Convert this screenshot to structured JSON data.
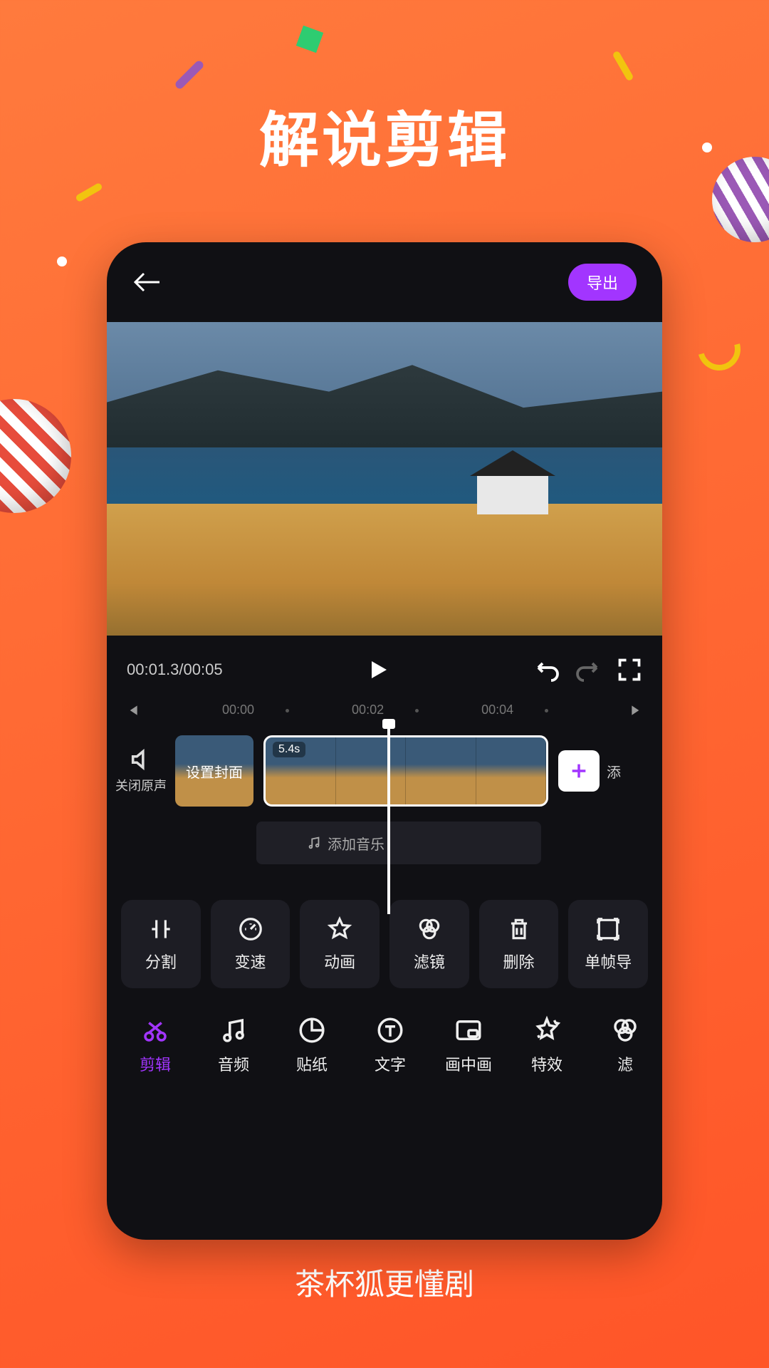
{
  "promo": {
    "title": "解说剪辑",
    "subtitle": "茶杯狐更懂剧"
  },
  "editor": {
    "export_label": "导出",
    "time_current": "00:01.3",
    "time_total": "00:05",
    "ruler_ticks": [
      "00:00",
      "00:02",
      "00:04"
    ],
    "mute_label": "关闭原声",
    "cover_label": "设置封面",
    "clip_duration": "5.4s",
    "add_clip_label": "添",
    "add_music_label": "添加音乐"
  },
  "tools": [
    {
      "id": "split",
      "label": "分割"
    },
    {
      "id": "speed",
      "label": "变速"
    },
    {
      "id": "animation",
      "label": "动画"
    },
    {
      "id": "filter",
      "label": "滤镜"
    },
    {
      "id": "delete",
      "label": "删除"
    },
    {
      "id": "frame-export",
      "label": "单帧导"
    }
  ],
  "nav": [
    {
      "id": "edit",
      "label": "剪辑",
      "active": true
    },
    {
      "id": "audio",
      "label": "音频"
    },
    {
      "id": "sticker",
      "label": "贴纸"
    },
    {
      "id": "text",
      "label": "文字"
    },
    {
      "id": "pip",
      "label": "画中画"
    },
    {
      "id": "effect",
      "label": "特效"
    },
    {
      "id": "filter2",
      "label": "滤"
    }
  ]
}
